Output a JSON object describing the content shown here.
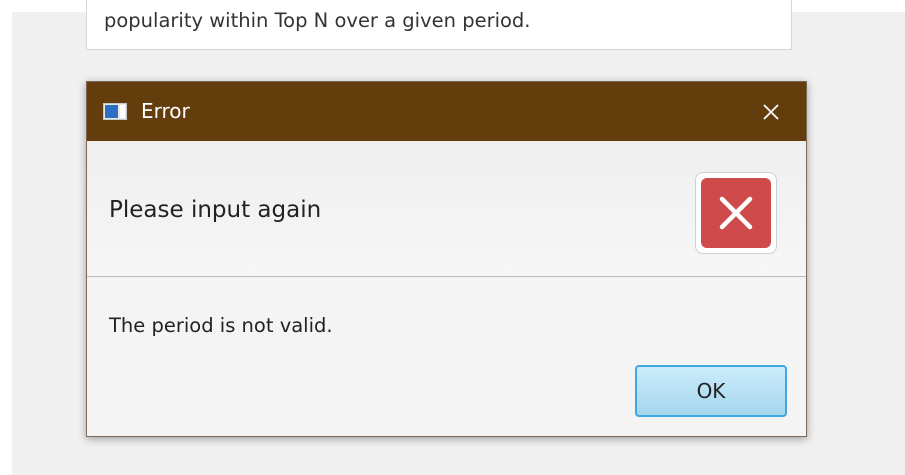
{
  "background": {
    "text": "popularity within Top N over a given period."
  },
  "dialog": {
    "title": "Error",
    "header_text": "Please input again",
    "content_text": "The period is not valid.",
    "ok_label": "OK",
    "icons": {
      "title": "app-window-icon",
      "close": "close-icon",
      "graphic": "error-x-icon"
    },
    "colors": {
      "titlebar": "#633d0c",
      "error": "#cf4b4b",
      "button_border": "#41a7e0"
    }
  }
}
